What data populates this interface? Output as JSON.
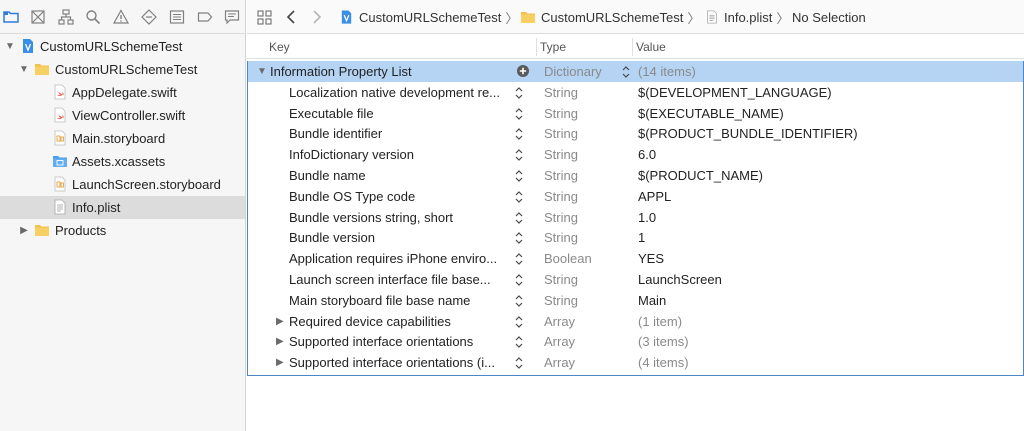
{
  "navigator": {
    "toolbar_icons": [
      "folder-icon",
      "source-control-icon",
      "hierarchy-icon",
      "find-icon",
      "issue-warning-icon",
      "test-diamond-icon",
      "debug-list-icon",
      "breakpoint-icon",
      "report-icon"
    ],
    "items": [
      {
        "label": "CustomURLSchemeTest",
        "icon": "project-icon",
        "expanded": true
      },
      {
        "label": "CustomURLSchemeTest",
        "icon": "folder-icon",
        "expanded": true
      },
      {
        "label": "AppDelegate.swift",
        "icon": "swift-file-icon"
      },
      {
        "label": "ViewController.swift",
        "icon": "swift-file-icon"
      },
      {
        "label": "Main.storyboard",
        "icon": "storyboard-icon"
      },
      {
        "label": "Assets.xcassets",
        "icon": "asset-catalog-icon"
      },
      {
        "label": "LaunchScreen.storyboard",
        "icon": "storyboard-icon"
      },
      {
        "label": "Info.plist",
        "icon": "plist-file-icon",
        "selected": true
      },
      {
        "label": "Products",
        "icon": "folder-icon",
        "expanded": false
      }
    ]
  },
  "jumpbar": {
    "crumbs": [
      "CustomURLSchemeTest",
      "CustomURLSchemeTest",
      "Info.plist",
      "No Selection"
    ]
  },
  "plist": {
    "columns": {
      "key": "Key",
      "type": "Type",
      "value": "Value"
    },
    "root": {
      "key": "Information Property List",
      "type": "Dictionary",
      "value": "(14 items)"
    },
    "rows": [
      {
        "key": "Localization native development re...",
        "type": "String",
        "value": "$(DEVELOPMENT_LANGUAGE)"
      },
      {
        "key": "Executable file",
        "type": "String",
        "value": "$(EXECUTABLE_NAME)"
      },
      {
        "key": "Bundle identifier",
        "type": "String",
        "value": "$(PRODUCT_BUNDLE_IDENTIFIER)"
      },
      {
        "key": "InfoDictionary version",
        "type": "String",
        "value": "6.0"
      },
      {
        "key": "Bundle name",
        "type": "String",
        "value": "$(PRODUCT_NAME)"
      },
      {
        "key": "Bundle OS Type code",
        "type": "String",
        "value": "APPL"
      },
      {
        "key": "Bundle versions string, short",
        "type": "String",
        "value": "1.0"
      },
      {
        "key": "Bundle version",
        "type": "String",
        "value": "1"
      },
      {
        "key": "Application requires iPhone enviro...",
        "type": "Boolean",
        "value": "YES"
      },
      {
        "key": "Launch screen interface file base...",
        "type": "String",
        "value": "LaunchScreen"
      },
      {
        "key": "Main storyboard file base name",
        "type": "String",
        "value": "Main"
      },
      {
        "key": "Required device capabilities",
        "type": "Array",
        "value": "(1 item)",
        "collapsible": true
      },
      {
        "key": "Supported interface orientations",
        "type": "Array",
        "value": "(3 items)",
        "collapsible": true
      },
      {
        "key": "Supported interface orientations (i...",
        "type": "Array",
        "value": "(4 items)",
        "collapsible": true
      }
    ]
  },
  "colors": {
    "selection_row": "#b5d3f3",
    "focus_border": "#4a86c8",
    "navigator_bg": "#f6f6f6",
    "folder_yellow": "#f2c14e",
    "swift_orange": "#f05138",
    "project_blue": "#3a8ee6"
  }
}
